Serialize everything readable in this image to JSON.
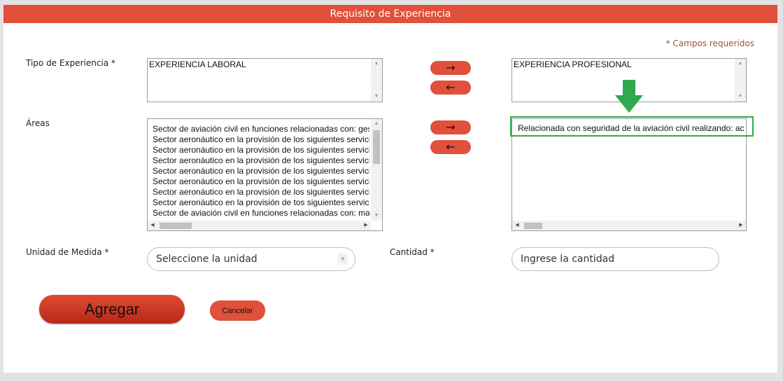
{
  "header": {
    "title": "Requisito de Experiencia"
  },
  "required_note": "* Campos requeridos",
  "tipo": {
    "label": "Tipo de Experiencia *",
    "available": [
      "EXPERIENCIA LABORAL"
    ],
    "selected": [
      "EXPERIENCIA PROFESIONAL"
    ]
  },
  "areas": {
    "label": "Áreas",
    "available": [
      "Sector de aviación civil en funciones relacionadas con: gestión",
      "Sector aeronáutico en la provisión de los siguientes servicios",
      "Sector aeronáutico en la provisión de los siguientes servicios",
      "Sector aeronáutico en la provisión de los siguientes servicios",
      "Sector aeronáutico en la provisión de los siguientes servicios",
      "Sector aeronáutico en la provisión de los siguientes servicios",
      "Sector aeronáutico en la provisión de los siguientes servicios",
      "Sector aeronáutico en la provisión de tos siguientes servicios",
      "Sector de aviación civil en funciones relacionadas con: manten"
    ],
    "selected": [
      "Relacionada con seguridad de la aviación civil realizando: actividades"
    ]
  },
  "buttons": {
    "add_arrow": "→",
    "remove_arrow": "←",
    "agregar": "Agregar",
    "cancelar": "Cancelar"
  },
  "unidad": {
    "label": "Unidad de Medida *",
    "placeholder": "Seleccione la unidad"
  },
  "cantidad": {
    "label": "Cantidad *",
    "placeholder": "Ingrese la cantidad"
  },
  "colors": {
    "accent": "#e0503a",
    "highlight": "#2fa84f",
    "note": "#a0522d"
  },
  "icons": {
    "scroll_up": "scroll-up-icon",
    "scroll_down": "scroll-down-icon",
    "annotation_arrow": "green-down-arrow-icon"
  }
}
